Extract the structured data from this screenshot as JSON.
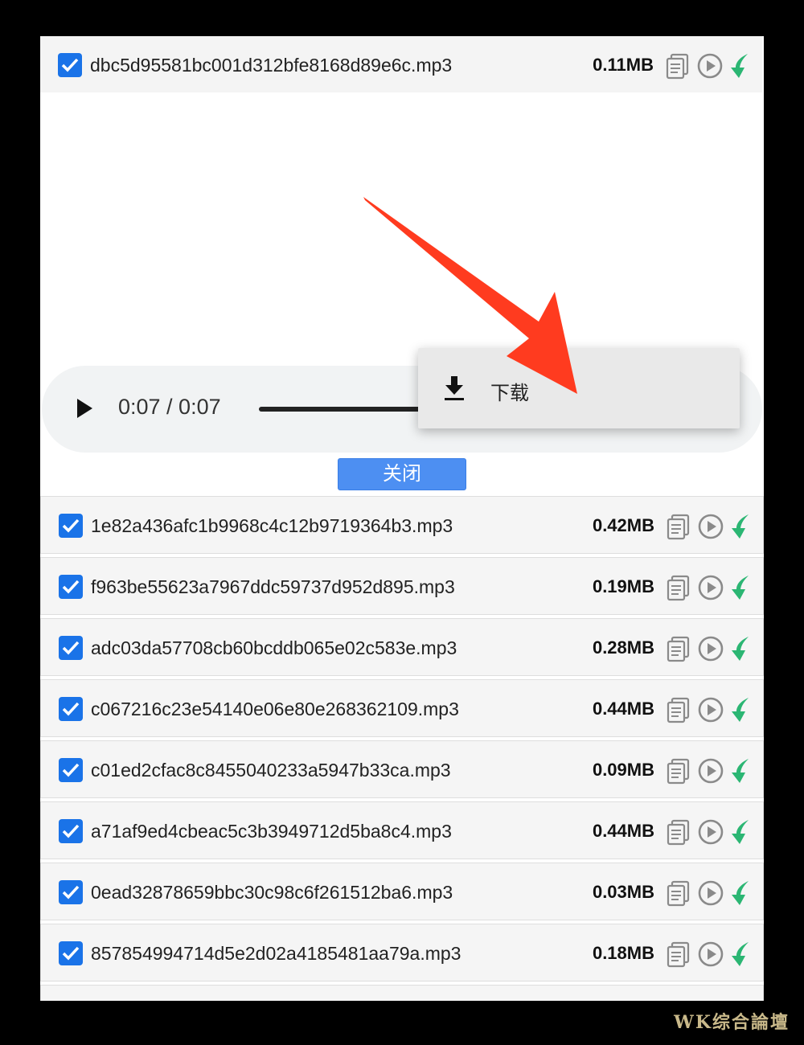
{
  "files": [
    {
      "name": "dbc5d95581bc001d312bfe8168d89e6c.mp3",
      "size": "0.11MB",
      "checked": true
    },
    {
      "name": "1e82a436afc1b9968c4c12b9719364b3.mp3",
      "size": "0.42MB",
      "checked": true
    },
    {
      "name": "f963be55623a7967ddc59737d952d895.mp3",
      "size": "0.19MB",
      "checked": true
    },
    {
      "name": "adc03da57708cb60bcddb065e02c583e.mp3",
      "size": "0.28MB",
      "checked": true
    },
    {
      "name": "c067216c23e54140e06e80e268362109.mp3",
      "size": "0.44MB",
      "checked": true
    },
    {
      "name": "c01ed2cfac8c8455040233a5947b33ca.mp3",
      "size": "0.09MB",
      "checked": true
    },
    {
      "name": "a71af9ed4cbeac5c3b3949712d5ba8c4.mp3",
      "size": "0.44MB",
      "checked": true
    },
    {
      "name": "0ead32878659bbc30c98c6f261512ba6.mp3",
      "size": "0.03MB",
      "checked": true
    },
    {
      "name": "857854994714d5e2d02a4185481aa79a.mp3",
      "size": "0.18MB",
      "checked": true
    }
  ],
  "player": {
    "time": "0:07 / 0:07",
    "progress": 0.45
  },
  "context_menu": {
    "download_label": "下载",
    "icon": "download-icon"
  },
  "close_button": "关闭",
  "watermark": "WK综合論壇",
  "icons": {
    "row_actions": [
      "copy-icon",
      "play-circle-icon",
      "download-leaf-icon"
    ]
  },
  "colors": {
    "checkbox": "#1a73e8",
    "close_button": "#4d8ff2",
    "arrow": "#ff3b1f",
    "download_icon": "#2bb673"
  }
}
